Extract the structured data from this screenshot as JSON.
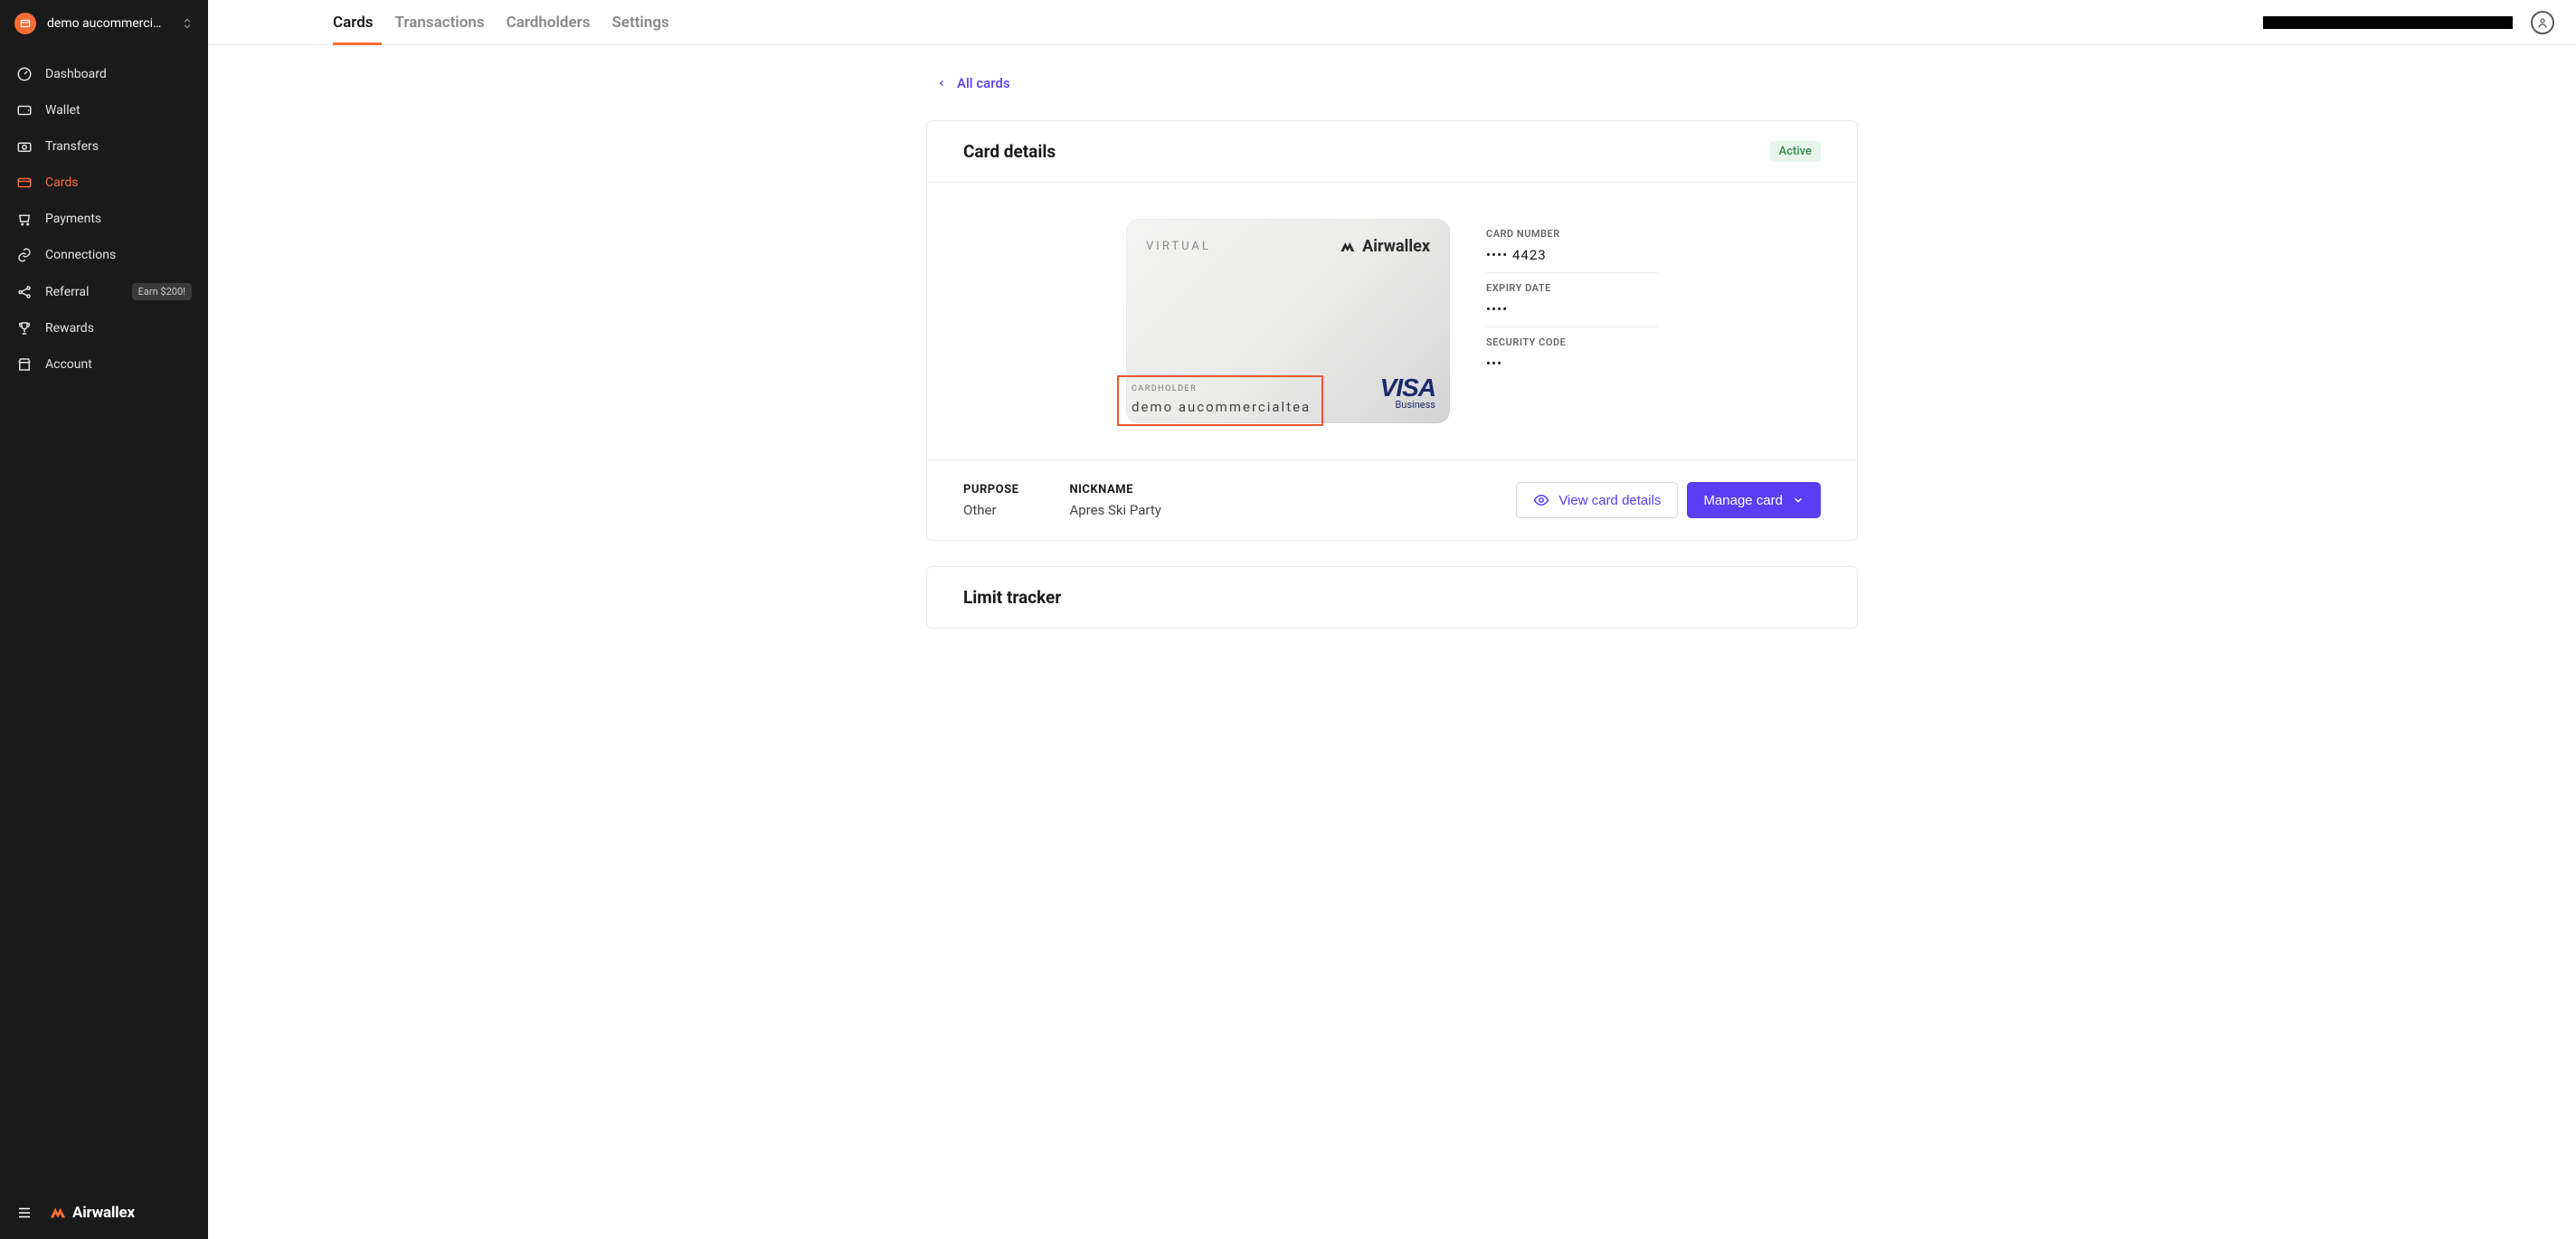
{
  "org": {
    "name": "demo aucommerci…"
  },
  "sidebar": {
    "items": [
      {
        "label": "Dashboard",
        "icon": "gauge-icon"
      },
      {
        "label": "Wallet",
        "icon": "wallet-icon"
      },
      {
        "label": "Transfers",
        "icon": "camera-icon"
      },
      {
        "label": "Cards",
        "icon": "card-icon",
        "active": true
      },
      {
        "label": "Payments",
        "icon": "cart-icon"
      },
      {
        "label": "Connections",
        "icon": "link-icon"
      },
      {
        "label": "Referral",
        "icon": "share-icon",
        "badge": "Earn $200!"
      },
      {
        "label": "Rewards",
        "icon": "trophy-icon"
      },
      {
        "label": "Account",
        "icon": "store-icon"
      }
    ],
    "brand": "Airwallex"
  },
  "tabs": [
    {
      "label": "Cards",
      "active": true
    },
    {
      "label": "Transactions"
    },
    {
      "label": "Cardholders"
    },
    {
      "label": "Settings"
    }
  ],
  "backlink": "All cards",
  "card_details": {
    "heading": "Card details",
    "status": "Active",
    "virtual_label": "VIRTUAL",
    "brand_on_card": "Airwallex",
    "cardholder_label": "CARDHOLDER",
    "cardholder_name": "demo aucommercialtea…",
    "network": "VISA",
    "network_sub": "Business",
    "fields": {
      "card_number_label": "CARD NUMBER",
      "card_number_value": "•••• 4423",
      "expiry_label": "EXPIRY DATE",
      "expiry_value": "••••",
      "cvc_label": "SECURITY CODE",
      "cvc_value": "•••"
    },
    "meta": {
      "purpose_label": "PURPOSE",
      "purpose_value": "Other",
      "nickname_label": "NICKNAME",
      "nickname_value": "Apres Ski Party"
    },
    "actions": {
      "view": "View card details",
      "manage": "Manage card"
    }
  },
  "limit_tracker": {
    "heading": "Limit tracker"
  }
}
